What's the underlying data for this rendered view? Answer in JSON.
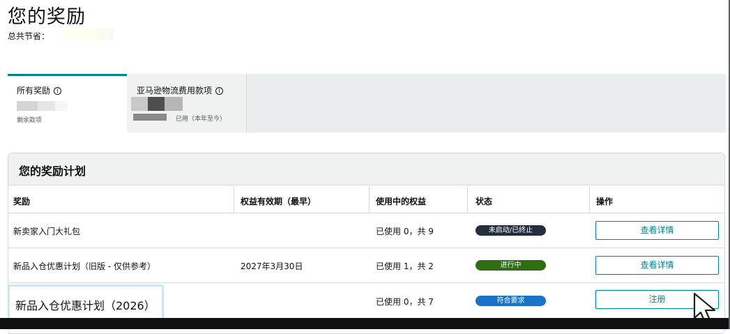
{
  "page": {
    "title": "您的奖励",
    "savings_label": "总共节省："
  },
  "tabs": [
    {
      "label": "所有奖励",
      "sub": "剩余款项"
    },
    {
      "label": "亚马逊物流费用款项",
      "sub": "已用（本年至今）"
    }
  ],
  "program": {
    "title": "您的奖励计划",
    "columns": [
      "奖励",
      "权益有效期（最早）",
      "使用中的权益",
      "状态",
      "操作"
    ],
    "rows": [
      {
        "name": "新卖家入门大礼包",
        "expiry": "",
        "usage": "已使用 0，共 9",
        "status": "未启动/已终止",
        "status_color": "#232f3e",
        "action": "查看详情"
      },
      {
        "name": "新品入仓优惠计划（旧版 - 仅供参考）",
        "expiry": "2027年3月30日",
        "usage": "已使用 1，共 2",
        "status": "进行中",
        "status_color": "#2f6d12",
        "action": "查看详情"
      },
      {
        "name": "新品入仓优惠计划（2026）",
        "expiry": "",
        "usage": "已使用 0，共 7",
        "status": "符合要求",
        "status_color": "#1a73c7",
        "action": "注册"
      }
    ]
  },
  "icons": {
    "info": "info-icon",
    "cursor": "pointer-cursor-icon"
  },
  "colors": {
    "accent": "#008296",
    "tab_bar": "#eaeded",
    "header_bg": "#f0f2f2"
  }
}
